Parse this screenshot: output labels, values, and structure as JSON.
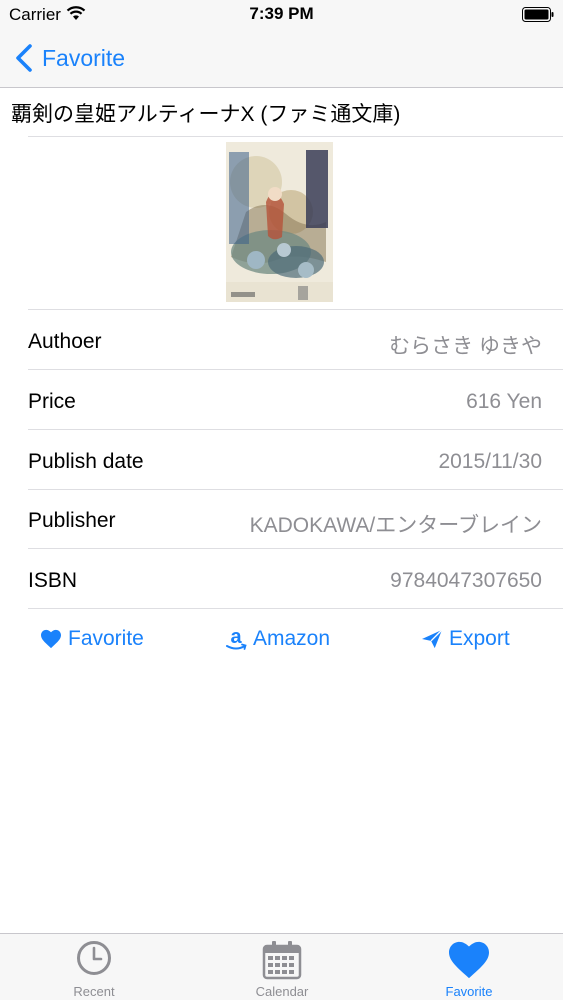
{
  "status_bar": {
    "carrier": "Carrier",
    "time": "7:39 PM"
  },
  "nav": {
    "back_label": "Favorite"
  },
  "book": {
    "title": "覇剣の皇姫アルティーナX (ファミ通文庫)",
    "details": [
      {
        "label": "Authoer",
        "value": "むらさき ゆきや"
      },
      {
        "label": "Price",
        "value": "616 Yen"
      },
      {
        "label": "Publish date",
        "value": "2015/11/30"
      },
      {
        "label": "Publisher",
        "value": "KADOKAWA/エンターブレイン"
      },
      {
        "label": "ISBN",
        "value": "9784047307650"
      }
    ]
  },
  "actions": {
    "favorite": "Favorite",
    "amazon": "Amazon",
    "export": "Export"
  },
  "tabs": [
    {
      "label": "Recent",
      "icon": "clock-icon"
    },
    {
      "label": "Calendar",
      "icon": "calendar-icon"
    },
    {
      "label": "Favorite",
      "icon": "heart-icon",
      "active": true
    }
  ],
  "colors": {
    "accent": "#1a82fb",
    "secondary_text": "#8e8e93",
    "bar_background": "#f7f7f7"
  }
}
